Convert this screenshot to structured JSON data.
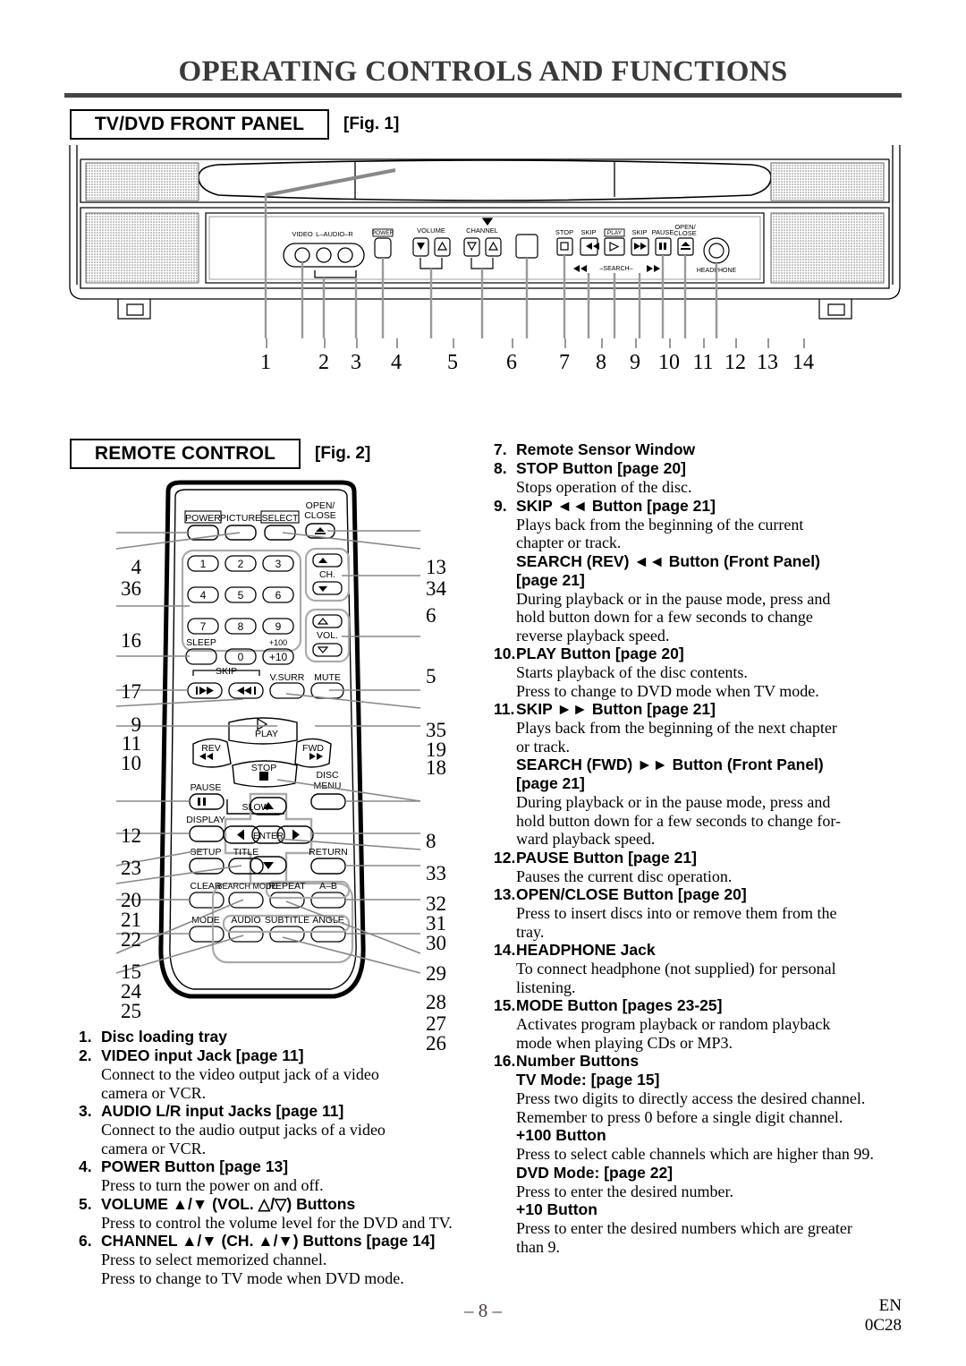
{
  "page": {
    "title": "OPERATING CONTROLS AND FUNCTIONS",
    "page_number": "– 8 –",
    "footer_lang": "EN",
    "footer_code": "0C28"
  },
  "sections": {
    "front_panel": {
      "label": "TV/DVD FRONT PANEL",
      "figure": "[Fig. 1]"
    },
    "remote": {
      "label": "REMOTE CONTROL",
      "figure": "[Fig. 2]"
    }
  },
  "front_panel_figure": {
    "jack_labels": [
      "VIDEO",
      "L–AUDIO–R"
    ],
    "power_label": "POWER",
    "volume_label": "VOLUME",
    "channel_label": "CHANNEL",
    "stop_label": "STOP",
    "skip_prev_label": "SKIP",
    "play_label": "PLAY",
    "skip_next_label": "SKIP",
    "pause_label": "PAUSE",
    "open_close_label": [
      "OPEN/",
      "CLOSE"
    ],
    "search_label": "–SEARCH–",
    "headphone_label": "HEADPHONE",
    "callouts": [
      "1",
      "2",
      "3",
      "4",
      "5",
      "6",
      "7",
      "8",
      "9",
      "10",
      "11",
      "12",
      "13",
      "14"
    ]
  },
  "remote_figure": {
    "buttons": {
      "power": "POWER",
      "picture": "PICTURE",
      "select": "SELECT",
      "open_close": [
        "OPEN/",
        "CLOSE"
      ],
      "numbers": [
        "1",
        "2",
        "3",
        "4",
        "5",
        "6",
        "7",
        "8",
        "9",
        "0"
      ],
      "plus100": "+100",
      "plus10": "+10",
      "sleep": "SLEEP",
      "ch": "CH.",
      "vol": "VOL.",
      "skip": "SKIP",
      "vsurr": "V.SURR",
      "mute": "MUTE",
      "play": "PLAY",
      "rev": "REV",
      "fwd": "FWD",
      "stop": "STOP",
      "slow": "SLOW",
      "pause": "PAUSE",
      "disc_menu": [
        "DISC",
        "MENU"
      ],
      "display": "DISPLAY",
      "enter": "ENTER",
      "setup": "SETUP",
      "title": "TITLE",
      "return": "RETURN",
      "clear": "CLEAR",
      "search_mode": "SEARCH MODE",
      "repeat": "REPEAT",
      "ab": "A–B",
      "mode": "MODE",
      "audio": "AUDIO",
      "subtitle": "SUBTITLE",
      "angle": "ANGLE"
    },
    "callouts_left": [
      "4",
      "36",
      "16",
      "17",
      "9",
      "11",
      "10",
      "12",
      "23",
      "20",
      "21",
      "22",
      "15",
      "24",
      "25"
    ],
    "callouts_right": [
      "13",
      "34",
      "6",
      "5",
      "35",
      "19",
      "18",
      "8",
      "33",
      "32",
      "31",
      "30",
      "29",
      "28",
      "27",
      "26"
    ]
  },
  "list_left": [
    {
      "num": "1.",
      "head": "Disc loading tray",
      "body": []
    },
    {
      "num": "2.",
      "head": "VIDEO input Jack [page 11]",
      "body": [
        "Connect to the video output jack of a video",
        "camera or VCR."
      ]
    },
    {
      "num": "3.",
      "head": "AUDIO L/R input Jacks [page 11]",
      "body": [
        "Connect to the audio output jacks of a video",
        "camera or VCR."
      ]
    },
    {
      "num": "4.",
      "head": "POWER Button [page 13]",
      "body": [
        "Press to turn the power on and off."
      ]
    },
    {
      "num": "5.",
      "head": "VOLUME ▲/▼ (VOL. △/▽) Buttons",
      "body": [
        "Press to control the volume level for the DVD and TV."
      ]
    },
    {
      "num": "6.",
      "head": "CHANNEL ▲/▼ (CH. ▲/▼) Buttons [page 14]",
      "body": [
        "Press to select memorized channel.",
        "Press to change to TV mode when DVD mode."
      ]
    }
  ],
  "list_right": [
    {
      "num": "7.",
      "head": "Remote Sensor Window",
      "body": []
    },
    {
      "num": "8.",
      "head": "STOP Button [page 20]",
      "body": [
        "Stops operation of the disc."
      ]
    },
    {
      "num": "9.",
      "head": "SKIP ◄◄ Button [page 21]",
      "body": [
        "Plays back from the beginning of the current",
        "chapter or track."
      ],
      "sub_head": [
        "SEARCH (REV) ◄◄ Button (Front Panel)",
        "[page 21]"
      ],
      "sub_body": [
        "During playback or in the pause mode, press and",
        "hold button down for a few seconds to change",
        "reverse playback speed."
      ]
    },
    {
      "num": "10.",
      "head": "PLAY Button [page 20]",
      "body": [
        "Starts playback of the disc contents.",
        "Press to change to DVD mode when TV mode."
      ]
    },
    {
      "num": "11.",
      "head": "SKIP ►► Button [page 21]",
      "body": [
        "Plays back from the beginning of the next chapter",
        "or track."
      ],
      "sub_head": [
        "SEARCH (FWD) ►► Button (Front Panel)",
        "[page 21]"
      ],
      "sub_body": [
        "During playback or in the pause mode, press and",
        "hold button down for a few seconds to change for-",
        "ward playback speed."
      ]
    },
    {
      "num": "12.",
      "head": "PAUSE Button [page 21]",
      "body": [
        "Pauses the current disc operation."
      ]
    },
    {
      "num": "13.",
      "head": "OPEN/CLOSE Button [page 20]",
      "body": [
        "Press to insert discs into or remove them from the",
        "tray."
      ]
    },
    {
      "num": "14.",
      "head": "HEADPHONE Jack",
      "body": [
        "To connect headphone (not supplied) for personal",
        "listening."
      ]
    },
    {
      "num": "15.",
      "head": "MODE Button [pages 23-25]",
      "body": [
        "Activates program playback or random playback",
        "mode when playing CDs or MP3."
      ]
    },
    {
      "num": "16.",
      "head": "Number Buttons",
      "body": [],
      "groups": [
        {
          "title": "TV Mode: [page 15]",
          "lines": [
            "Press two digits to directly access the desired channel.",
            "Remember to press 0 before a single digit channel."
          ]
        },
        {
          "title": "+100 Button",
          "lines": [
            "Press to select cable channels which are higher than 99."
          ]
        },
        {
          "title": "DVD Mode: [page 22]",
          "lines": [
            "Press to enter the desired number."
          ]
        },
        {
          "title": "+10 Button",
          "lines": [
            "Press to enter the desired numbers which are greater",
            "than 9."
          ]
        }
      ]
    }
  ]
}
